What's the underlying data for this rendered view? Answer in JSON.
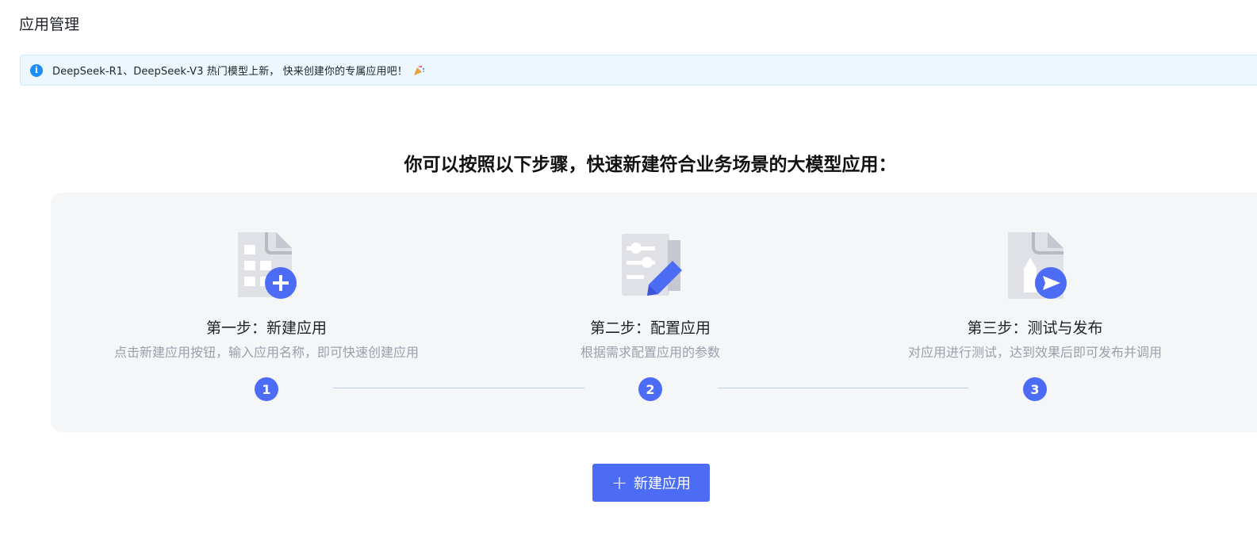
{
  "page": {
    "title": "应用管理"
  },
  "notice": {
    "text": "DeepSeek-R1、DeepSeek-V3 热门模型上新， 快来创建你的专属应用吧！",
    "icon": "info-circle-icon",
    "emoji_icon": "party-popper-icon"
  },
  "guide": {
    "title": "你可以按照以下步骤，快速新建符合业务场景的大模型应用：",
    "steps": [
      {
        "number": "1",
        "title": "第一步：新建应用",
        "description": "点击新建应用按钮，输入应用名称，即可快速创建应用",
        "icon": "new-document-plus-icon"
      },
      {
        "number": "2",
        "title": "第二步：配置应用",
        "description": "根据需求配置应用的参数",
        "icon": "config-edit-icon"
      },
      {
        "number": "3",
        "title": "第三步：测试与发布",
        "description": "对应用进行测试，达到效果后即可发布并调用",
        "icon": "document-send-icon"
      }
    ]
  },
  "actions": {
    "create_label": "新建应用",
    "create_icon": "plus-icon"
  },
  "colors": {
    "primary": "#4d6cf5",
    "notice_bg": "#ecf8fe",
    "panel_bg": "#f5f6f8",
    "muted_text": "#9aa0aa"
  }
}
